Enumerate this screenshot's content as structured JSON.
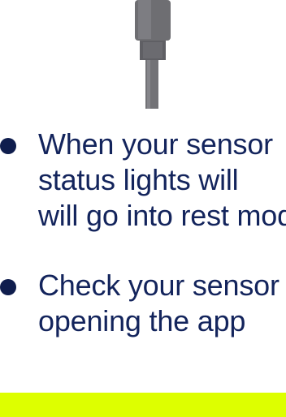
{
  "colors": {
    "text": "#13245c",
    "bullet": "#0f1d4d",
    "accent_bar": "#ddff00",
    "cable": "#6e6e72"
  },
  "illustration": {
    "icon": "usb-cable-icon"
  },
  "bullets": [
    {
      "lines": [
        "When your sensor",
        "status lights will",
        "will go into rest mode"
      ]
    },
    {
      "lines": [
        "Check your sensor",
        "opening the app"
      ]
    }
  ]
}
